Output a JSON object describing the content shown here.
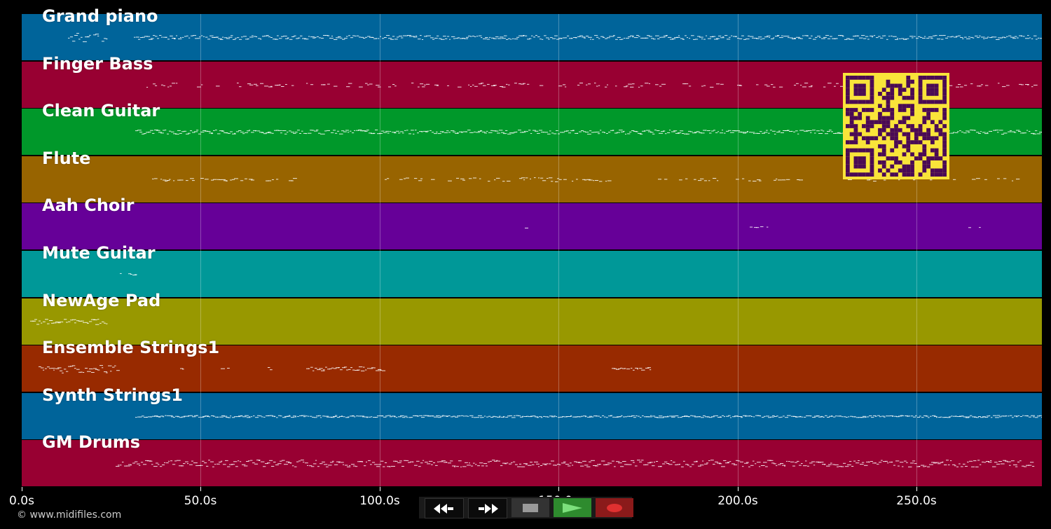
{
  "tracks": [
    {
      "name": "Grand piano",
      "color": "#00649a"
    },
    {
      "name": "Finger Bass",
      "color": "#980032"
    },
    {
      "name": "Clean Guitar",
      "color": "#00982a"
    },
    {
      "name": "Flute",
      "color": "#986400"
    },
    {
      "name": "Aah Choir",
      "color": "#660098"
    },
    {
      "name": "Mute Guitar",
      "color": "#009898"
    },
    {
      "name": "NewAge Pad",
      "color": "#989800"
    },
    {
      "name": "Ensemble Strings1",
      "color": "#982a00"
    },
    {
      "name": "Synth Strings1",
      "color": "#00649a"
    },
    {
      "name": "GM Drums",
      "color": "#980032"
    }
  ],
  "timeline": {
    "duration_s": 285,
    "ticks": [
      {
        "label": "0.0s",
        "t": 0
      },
      {
        "label": "50.0s",
        "t": 50
      },
      {
        "label": "100.0s",
        "t": 100
      },
      {
        "label": "150.0s",
        "t": 150
      },
      {
        "label": "200.0s",
        "t": 200
      },
      {
        "label": "250.0s",
        "t": 250
      }
    ]
  },
  "transport": {
    "rewind": "rewind-icon",
    "fast_forward": "fast-forward-icon",
    "stop": "stop-icon",
    "play": "play-icon",
    "record": "record-icon",
    "colors": {
      "play": "#2e8b2e",
      "record": "#8b1a1a"
    }
  },
  "copyright": "© www.midifiles.com",
  "qr_code": "qr-code-icon"
}
